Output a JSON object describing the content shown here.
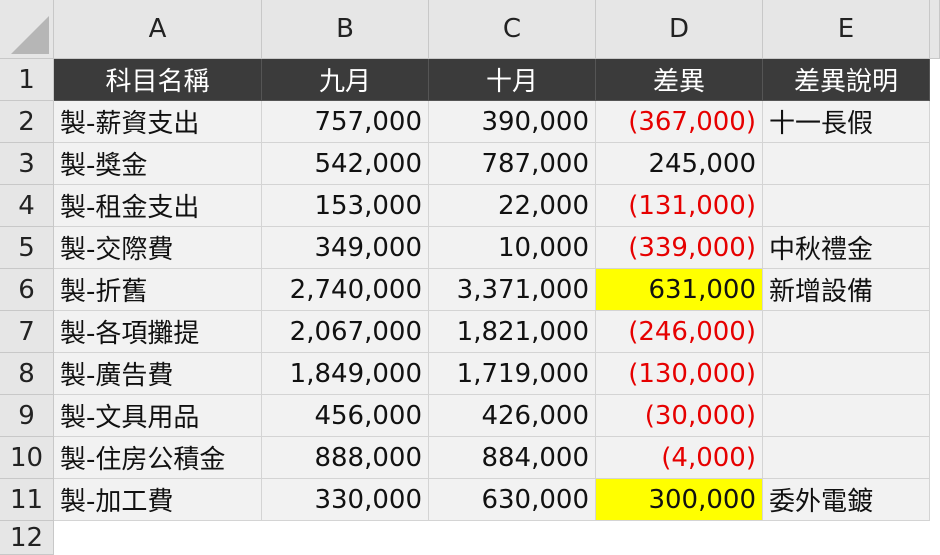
{
  "columns": [
    "A",
    "B",
    "C",
    "D",
    "E"
  ],
  "row_numbers": [
    "1",
    "2",
    "3",
    "4",
    "5",
    "6",
    "7",
    "8",
    "9",
    "10",
    "11",
    "12"
  ],
  "header": [
    "科目名稱",
    "九月",
    "十月",
    "差異",
    "差異說明"
  ],
  "rows": [
    {
      "item": "製-薪資支出",
      "sep": "757,000",
      "oct": "390,000",
      "diff": "(367,000)",
      "note": "十一長假"
    },
    {
      "item": "製-獎金",
      "sep": "542,000",
      "oct": "787,000",
      "diff": "245,000",
      "note": ""
    },
    {
      "item": "製-租金支出",
      "sep": "153,000",
      "oct": "22,000",
      "diff": "(131,000)",
      "note": ""
    },
    {
      "item": "製-交際費",
      "sep": "349,000",
      "oct": "10,000",
      "diff": "(339,000)",
      "note": "中秋禮金"
    },
    {
      "item": "製-折舊",
      "sep": "2,740,000",
      "oct": "3,371,000",
      "diff": "631,000",
      "note": "新增設備"
    },
    {
      "item": "製-各項攤提",
      "sep": "2,067,000",
      "oct": "1,821,000",
      "diff": "(246,000)",
      "note": ""
    },
    {
      "item": "製-廣告費",
      "sep": "1,849,000",
      "oct": "1,719,000",
      "diff": "(130,000)",
      "note": ""
    },
    {
      "item": "製-文具用品",
      "sep": "456,000",
      "oct": "426,000",
      "diff": "(30,000)",
      "note": ""
    },
    {
      "item": "製-住房公積金",
      "sep": "888,000",
      "oct": "884,000",
      "diff": "(4,000)",
      "note": ""
    },
    {
      "item": "製-加工費",
      "sep": "330,000",
      "oct": "630,000",
      "diff": "300,000",
      "note": "委外電鍍"
    }
  ],
  "highlighted_rows": [
    4,
    9
  ],
  "colors": {
    "header_bg": "#3b3b3b",
    "header_text": "#ffffff",
    "negative_text": "#e60000",
    "highlight": "#ffff00",
    "cell_bg": "#f2f2f2"
  }
}
